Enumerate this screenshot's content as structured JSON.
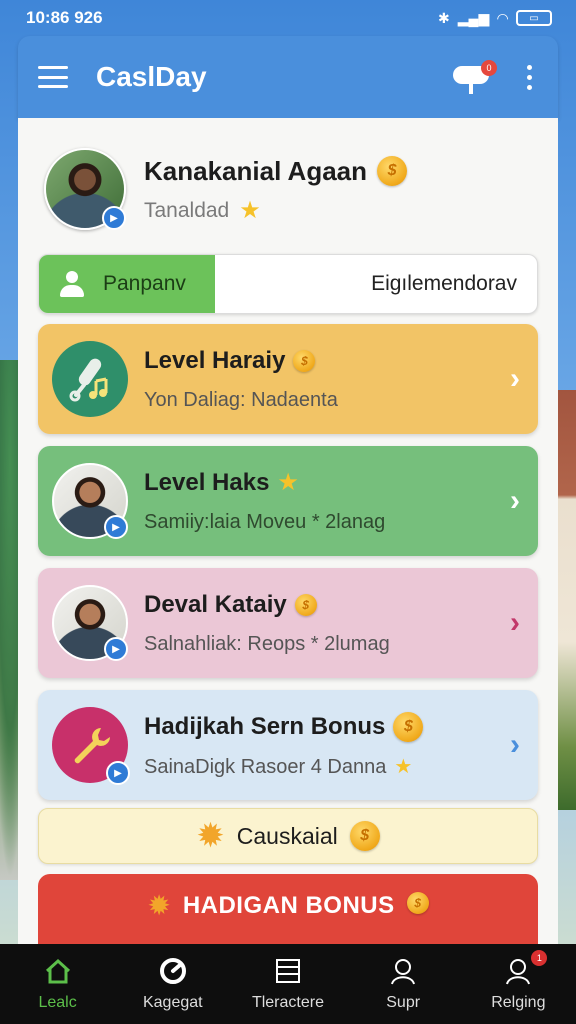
{
  "status_bar": {
    "time": "10:86 926"
  },
  "app_bar": {
    "title": "CaslDay",
    "toggle_badge": "0"
  },
  "profile": {
    "name": "Kanakanial Agaan",
    "subtitle": "Tanaldad"
  },
  "segment": {
    "left_label": "Panpanv",
    "right_label": "Eigılemendorav"
  },
  "cards": [
    {
      "title": "Level Haraiy",
      "subtitle": "Yon Daliag: Nadaenta",
      "icon": "microphone-music-icon",
      "color": "#f2c466"
    },
    {
      "title": "Level Haks",
      "subtitle": "Samiiy:laia Moveu * 2lanag",
      "icon": "avatar",
      "color": "#76bf7c"
    },
    {
      "title": "Deval Kataiy",
      "subtitle": "Salnahliak: Reops * 2lumag",
      "icon": "avatar",
      "color": "#ebc7d6"
    },
    {
      "title": "Hadijkah Sern Bonus",
      "subtitle": "SainaDigk Rasoer 4 Danna",
      "icon": "wrench-icon",
      "color": "#d8e7f4"
    }
  ],
  "banner_light": {
    "label": "Causkaial"
  },
  "banner_red": {
    "label": "HADIGAN BONUS"
  },
  "bottom_nav": [
    {
      "label": "Lealc",
      "icon": "home-icon",
      "active": true
    },
    {
      "label": "Kagegat",
      "icon": "gauge-icon",
      "active": false
    },
    {
      "label": "Tleractere",
      "icon": "list-icon",
      "active": false
    },
    {
      "label": "Supr",
      "icon": "person-icon",
      "active": false
    },
    {
      "label": "Relging",
      "icon": "profile-icon",
      "active": false,
      "badge": "1"
    }
  ],
  "colors": {
    "app_bar": "#4a8fdc",
    "accent_green": "#6cc25a",
    "bonus_red": "#e0453a",
    "nav_active": "#5cbf4a"
  }
}
